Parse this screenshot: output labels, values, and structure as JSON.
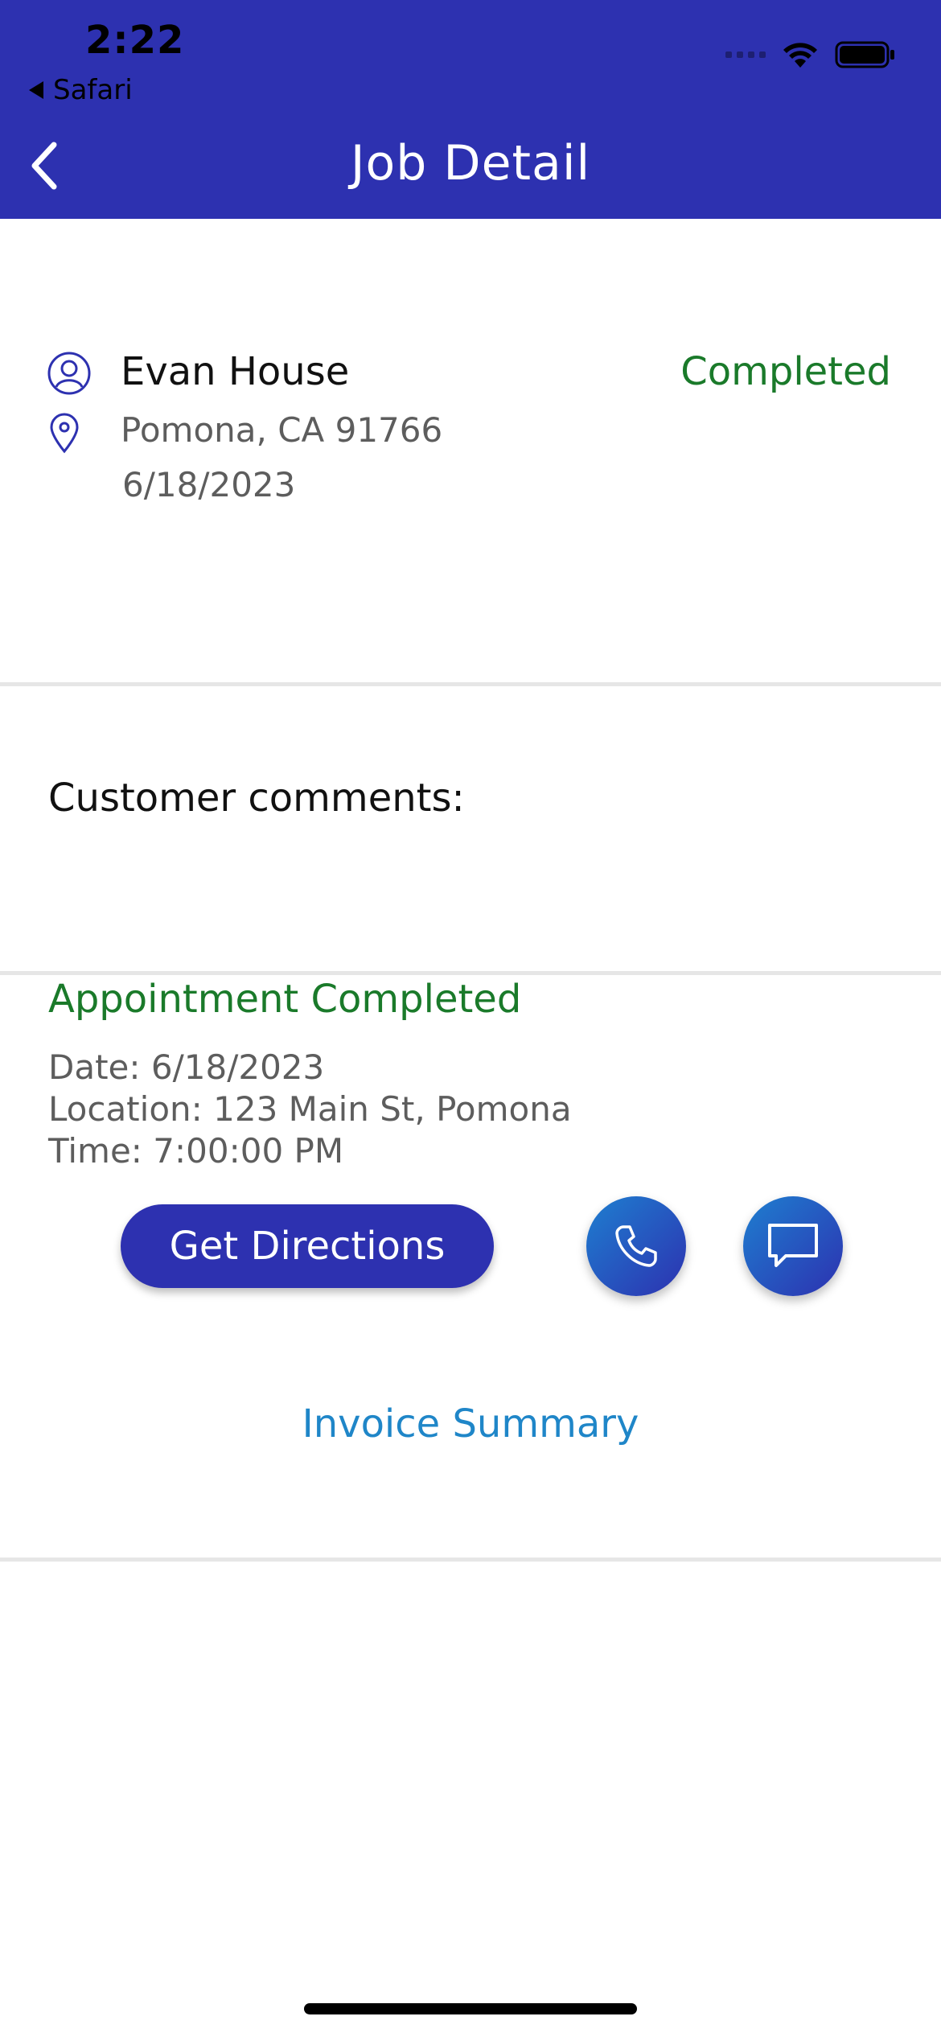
{
  "status_bar": {
    "time": "2:22",
    "back_app": "Safari"
  },
  "header": {
    "title": "Job Detail"
  },
  "customer": {
    "name": "Evan House",
    "address": "Pomona, CA 91766",
    "date": "6/18/2023",
    "status": "Completed"
  },
  "comments": {
    "label": "Customer comments:"
  },
  "appointment": {
    "title": "Appointment Completed",
    "date_line": "Date: 6/18/2023",
    "location_line": "Location: 123 Main St, Pomona",
    "time_line": "Time: 7:00:00 PM"
  },
  "actions": {
    "directions_label": "Get Directions",
    "call_icon": "phone-icon",
    "message_icon": "message-icon"
  },
  "invoice": {
    "link_label": "Invoice Summary"
  },
  "colors": {
    "brand": "#2d31b0",
    "status_green": "#1a7a2a",
    "link_blue": "#1f86c8"
  }
}
